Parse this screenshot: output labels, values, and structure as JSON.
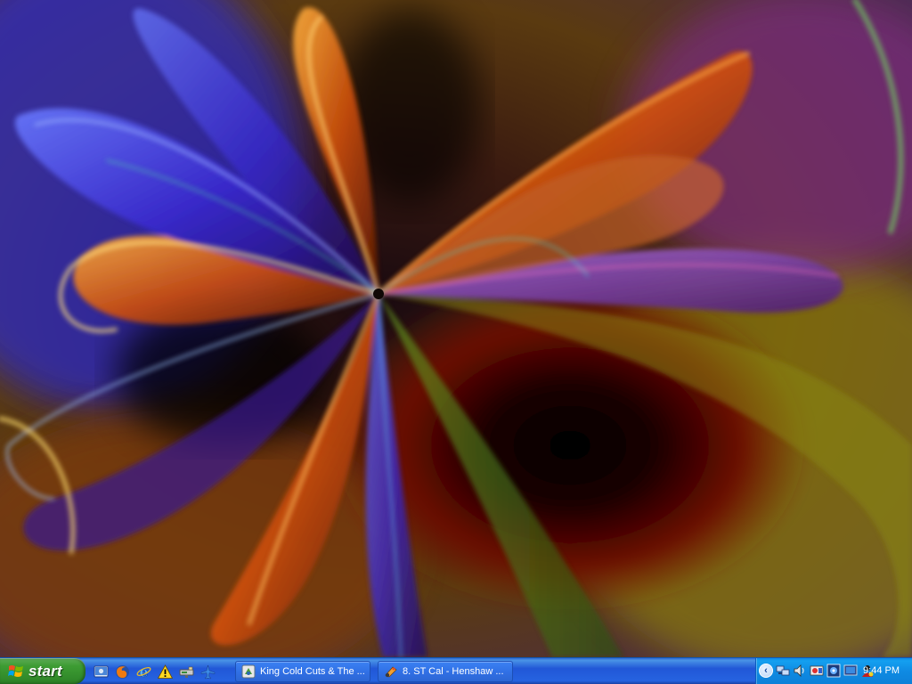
{
  "desktop": {
    "wallpaper": "abstract-swirl-wallpaper"
  },
  "taskbar": {
    "start_label": "start",
    "quick_launch": [
      {
        "icon": "show-desktop-icon"
      },
      {
        "icon": "firefox-icon"
      },
      {
        "icon": "internet-explorer-icon"
      },
      {
        "icon": "warning-icon"
      },
      {
        "icon": "network-drive-icon"
      },
      {
        "icon": "airplane-icon"
      }
    ],
    "tasks": [
      {
        "label": "King Cold Cuts & The ...",
        "icon": "app-icon"
      },
      {
        "label": "8. ST Cal - Henshaw ...",
        "icon": "media-player-icon"
      }
    ],
    "tray": {
      "icons": [
        "network-icon",
        "volume-icon",
        "antivirus-icon",
        "display-icon",
        "monitor-icon",
        "user-icon"
      ],
      "clock": "9:44 PM"
    }
  },
  "colors": {
    "taskbar_blue": "#245edb",
    "start_green": "#3d9c33",
    "tray_blue": "#0f8be3"
  }
}
